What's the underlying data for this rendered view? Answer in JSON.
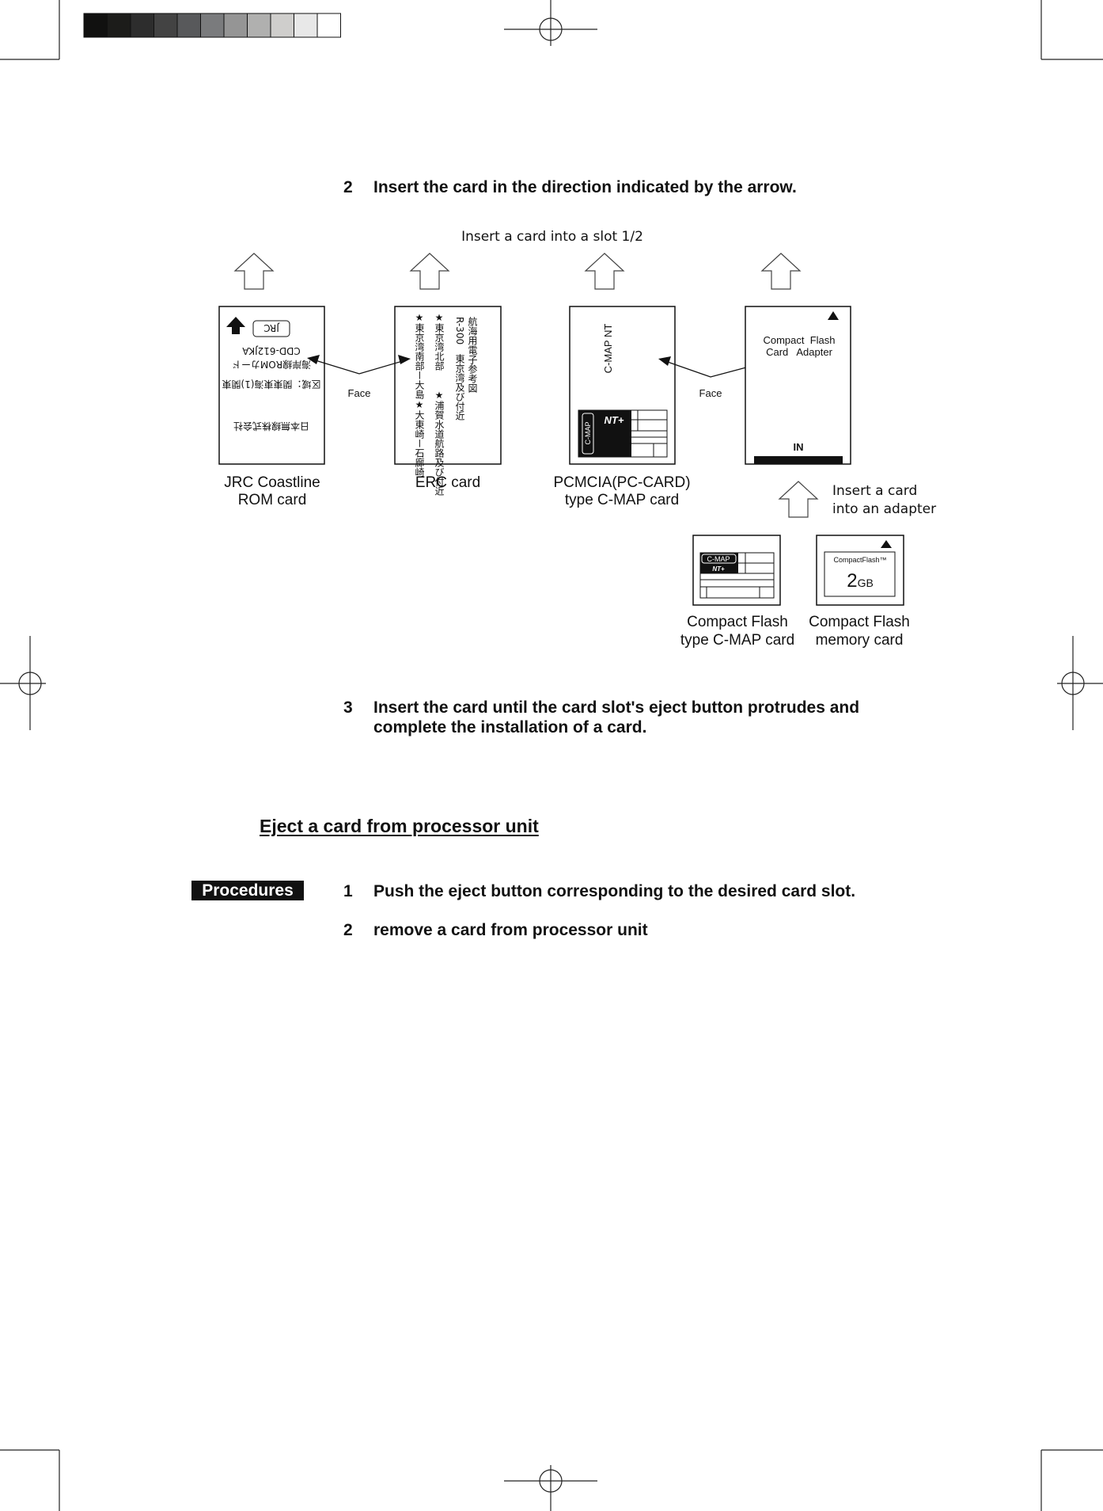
{
  "install_steps": [
    {
      "number": "2",
      "text": "Insert the card in the direction indicated by the arrow."
    },
    {
      "number": "3",
      "text_line1": "Insert the card until the card slot's eject button protrudes and",
      "text_line2": "complete the installation of a card."
    }
  ],
  "diagram": {
    "title": "Insert a card into a slot 1/2",
    "face_label": "Face",
    "adapter_insert_line1": "Insert a card",
    "adapter_insert_line2": "into an adapter",
    "cards": {
      "jrc": {
        "label_line1": "JRC Coastline",
        "label_line2": "ROM card",
        "text1": "日本無線株式会社",
        "text2": "区域：関東東海(1)関東",
        "text3": "海岸線ROMカード",
        "text4": "CDD-612JKA",
        "logo": "JRC"
      },
      "erc": {
        "label": "ERC card",
        "text1": "航海用電子参考図",
        "text2": "R-300　東京湾及び付近",
        "text3": "★東京湾北部　　★浦賀水道航路及び付近",
        "text4": "★東京湾南部ー大島★大東崎ー石廊崎"
      },
      "pcmcia": {
        "label_line1": "PCMCIA(PC-CARD)",
        "label_line2": "type C-MAP card",
        "title": "C-MAP NT",
        "brand": "C-MAP",
        "badge": "NT+"
      },
      "adapter": {
        "text_line1": "Compact  Flash",
        "text_line2": "Card   Adapter",
        "in_label": "IN"
      },
      "cf_cmap": {
        "label_line1": "Compact Flash",
        "label_line2": "type C-MAP card",
        "brand": "C-MAP",
        "badge": "NT+"
      },
      "cf_memory": {
        "label_line1": "Compact Flash",
        "label_line2": "memory card",
        "brand": "CompactFlash™",
        "capacity": "2",
        "unit": "GB"
      }
    }
  },
  "eject_section": {
    "heading": "Eject a card from processor unit",
    "procedures_label": "Procedures",
    "steps": [
      {
        "number": "1",
        "text": "Push the eject button corresponding to the desired card slot."
      },
      {
        "number": "2",
        "text": "remove a card from processor unit"
      }
    ]
  },
  "colors": {
    "gray_scale": [
      "#111110",
      "#1c1c1a",
      "#2d2d2d",
      "#434343",
      "#58595b",
      "#7a7b7d",
      "#959595",
      "#b0b0af",
      "#cfcecc",
      "#e8e8e8",
      "#ffffff"
    ]
  }
}
